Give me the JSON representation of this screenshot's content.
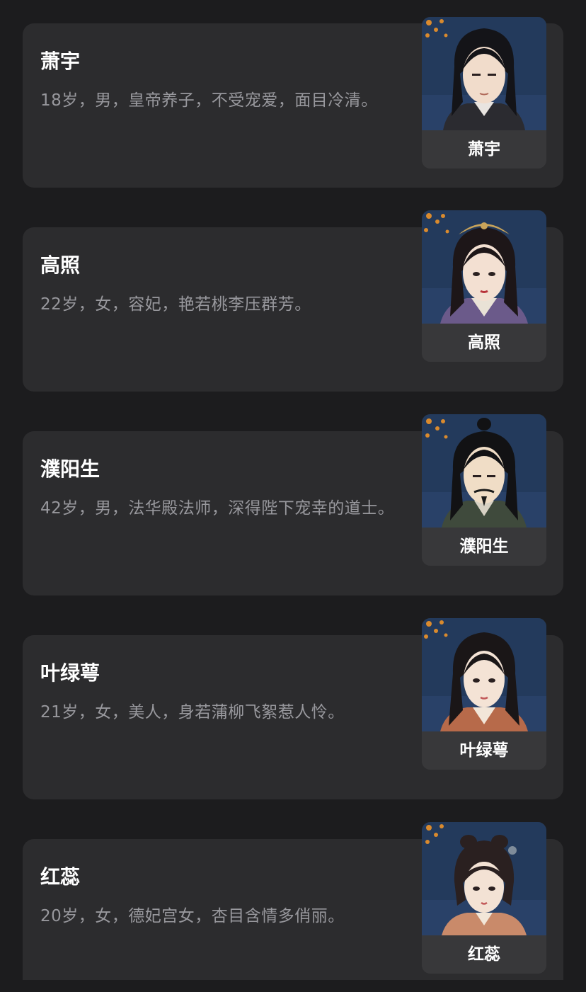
{
  "characters": [
    {
      "name": "萧宇",
      "description": "18岁，男，皇帝养子，不受宠爱，面目冷清。",
      "portrait_label": "萧宇",
      "portrait": "young-man-portrait",
      "hair_color": "#141418",
      "robe_color": "#2b2b30"
    },
    {
      "name": "高照",
      "description": "22岁，女，容妃，艳若桃李压群芳。",
      "portrait_label": "高照",
      "portrait": "consort-portrait",
      "hair_color": "#1d1618",
      "robe_color": "#6b5a8a"
    },
    {
      "name": "濮阳生",
      "description": "42岁，男，法华殿法师，深得陛下宠幸的道士。",
      "portrait_label": "濮阳生",
      "portrait": "taoist-priest-portrait",
      "hair_color": "#121214",
      "robe_color": "#3f4a3c"
    },
    {
      "name": "叶绿萼",
      "description": "21岁，女，美人，身若蒲柳飞絮惹人怜。",
      "portrait_label": "叶绿萼",
      "portrait": "beauty-portrait",
      "hair_color": "#1a1617",
      "robe_color": "#b76a4a"
    },
    {
      "name": "红蕊",
      "description": "20岁，女，德妃宫女，杏目含情多俏丽。",
      "portrait_label": "红蕊",
      "portrait": "palace-maid-portrait",
      "hair_color": "#2a2020",
      "robe_color": "#c98a6a"
    }
  ],
  "colors": {
    "background": "#1c1c1e",
    "card": "#2c2c2e",
    "name_text": "#ffffff",
    "description_text": "#98989d",
    "portrait_background": "#233a5c",
    "blossom": "#d98a2e"
  }
}
